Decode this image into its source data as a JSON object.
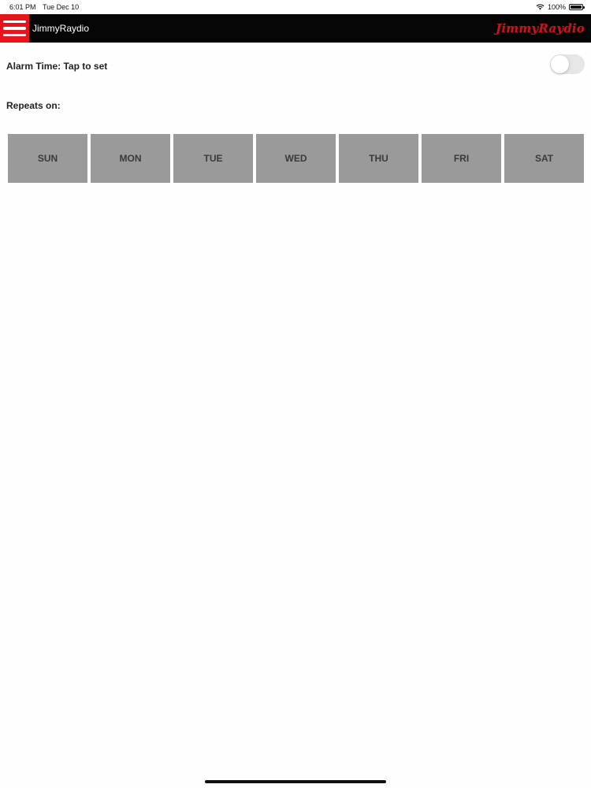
{
  "status_bar": {
    "time": "6:01 PM",
    "date": "Tue Dec 10",
    "battery": "100%",
    "wifi_icon": "wifi-icon",
    "battery_icon": "battery-icon"
  },
  "nav": {
    "title": "JimmyRaydio",
    "logo_text": "JimmyRaydio",
    "menu_icon": "hamburger-menu-icon",
    "menu_color": "#e8141b",
    "logo_color": "#c8141b"
  },
  "alarm": {
    "label": "Alarm Time: Tap to set",
    "enabled": false
  },
  "repeats": {
    "label": "Repeats on:",
    "days": [
      "SUN",
      "MON",
      "TUE",
      "WED",
      "THU",
      "FRI",
      "SAT"
    ]
  }
}
